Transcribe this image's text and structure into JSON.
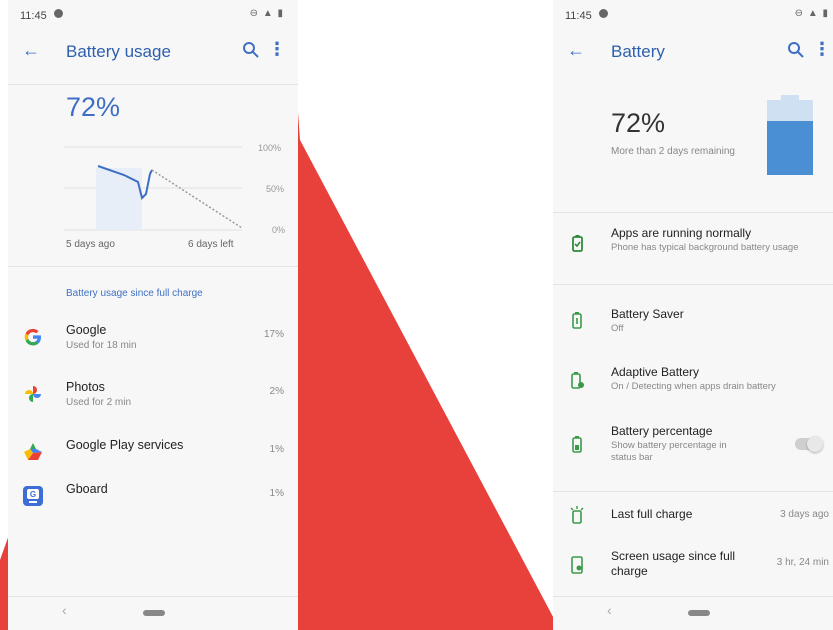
{
  "left_screen": {
    "status": {
      "time": "11:45"
    },
    "appbar": {
      "title": "Battery usage"
    },
    "battery_level": "72%",
    "chart": {
      "y_ticks": [
        "100%",
        "50%",
        "0%"
      ],
      "x_start_label": "5 days ago",
      "x_end_label": "6 days left"
    },
    "section_title": "Battery usage since full charge",
    "apps": [
      {
        "name": "Google",
        "subtitle": "Used for 18 min",
        "percent": "17%",
        "icon": "google-icon"
      },
      {
        "name": "Photos",
        "subtitle": "Used for 2 min",
        "percent": "2%",
        "icon": "photos-pinwheel-icon"
      },
      {
        "name": "Google Play services",
        "subtitle": "",
        "percent": "1%",
        "icon": "play-services-icon"
      },
      {
        "name": "Gboard",
        "subtitle": "",
        "percent": "1%",
        "icon": "gboard-icon"
      }
    ]
  },
  "right_screen": {
    "status": {
      "time": "11:45"
    },
    "appbar": {
      "title": "Battery"
    },
    "battery_level": "72%",
    "battery_remaining": "More than 2 days remaining",
    "battery_fill_fraction": 0.72,
    "items": [
      {
        "title": "Apps are running normally",
        "subtitle": "Phone has typical background battery usage",
        "icon": "battery-check-icon"
      },
      {
        "title": "Battery Saver",
        "subtitle": "Off",
        "icon": "battery-saver-icon"
      },
      {
        "title": "Adaptive Battery",
        "subtitle": "On / Detecting when apps drain battery",
        "icon": "adaptive-battery-icon"
      },
      {
        "title": "Battery percentage",
        "subtitle": "Show battery percentage in status bar",
        "icon": "battery-percent-icon",
        "toggle": false
      }
    ],
    "stats": [
      {
        "title": "Last full charge",
        "value": "3 days ago",
        "icon": "charging-icon"
      },
      {
        "title": "Screen usage since full charge",
        "value": "3 hr, 24 min",
        "icon": "screen-usage-icon"
      }
    ]
  },
  "colors": {
    "accent": "#3f6fc4",
    "background_shape": "#e8403a",
    "battery_fill": "#4a8fd4"
  }
}
